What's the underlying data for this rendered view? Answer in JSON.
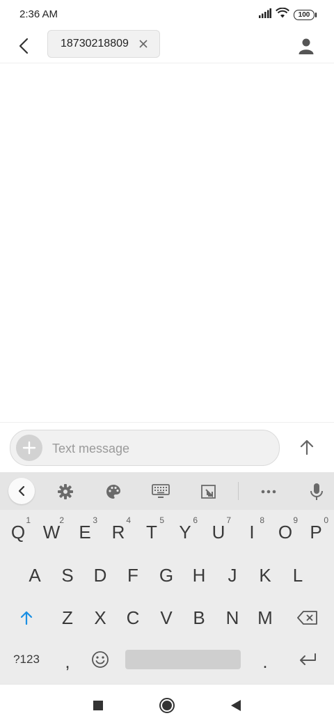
{
  "status_bar": {
    "time": "2:36 AM",
    "battery": "100"
  },
  "header": {
    "recipient": "18730218809"
  },
  "compose": {
    "placeholder": "Text message"
  },
  "keyboard": {
    "row1": [
      {
        "label": "Q",
        "hint": "1"
      },
      {
        "label": "W",
        "hint": "2"
      },
      {
        "label": "E",
        "hint": "3"
      },
      {
        "label": "R",
        "hint": "4"
      },
      {
        "label": "T",
        "hint": "5"
      },
      {
        "label": "Y",
        "hint": "6"
      },
      {
        "label": "U",
        "hint": "7"
      },
      {
        "label": "I",
        "hint": "8"
      },
      {
        "label": "O",
        "hint": "9"
      },
      {
        "label": "P",
        "hint": "0"
      }
    ],
    "row2": [
      "A",
      "S",
      "D",
      "F",
      "G",
      "H",
      "J",
      "K",
      "L"
    ],
    "row3": [
      "Z",
      "X",
      "C",
      "V",
      "B",
      "N",
      "M"
    ],
    "symbols_label": "?123",
    "comma_label": ",",
    "period_label": "."
  },
  "icons": {
    "back": "arrow-left-icon",
    "contact": "person-icon",
    "send": "arrow-up-icon",
    "settings": "gear-icon",
    "theme": "palette-icon",
    "keyboard": "keyboard-icon",
    "resize": "resize-icon",
    "more": "more-horizontal-icon",
    "mic": "mic-icon",
    "shift": "shift-arrow-icon",
    "backspace": "backspace-icon",
    "emoji": "smiley-icon",
    "enter": "enter-icon"
  }
}
